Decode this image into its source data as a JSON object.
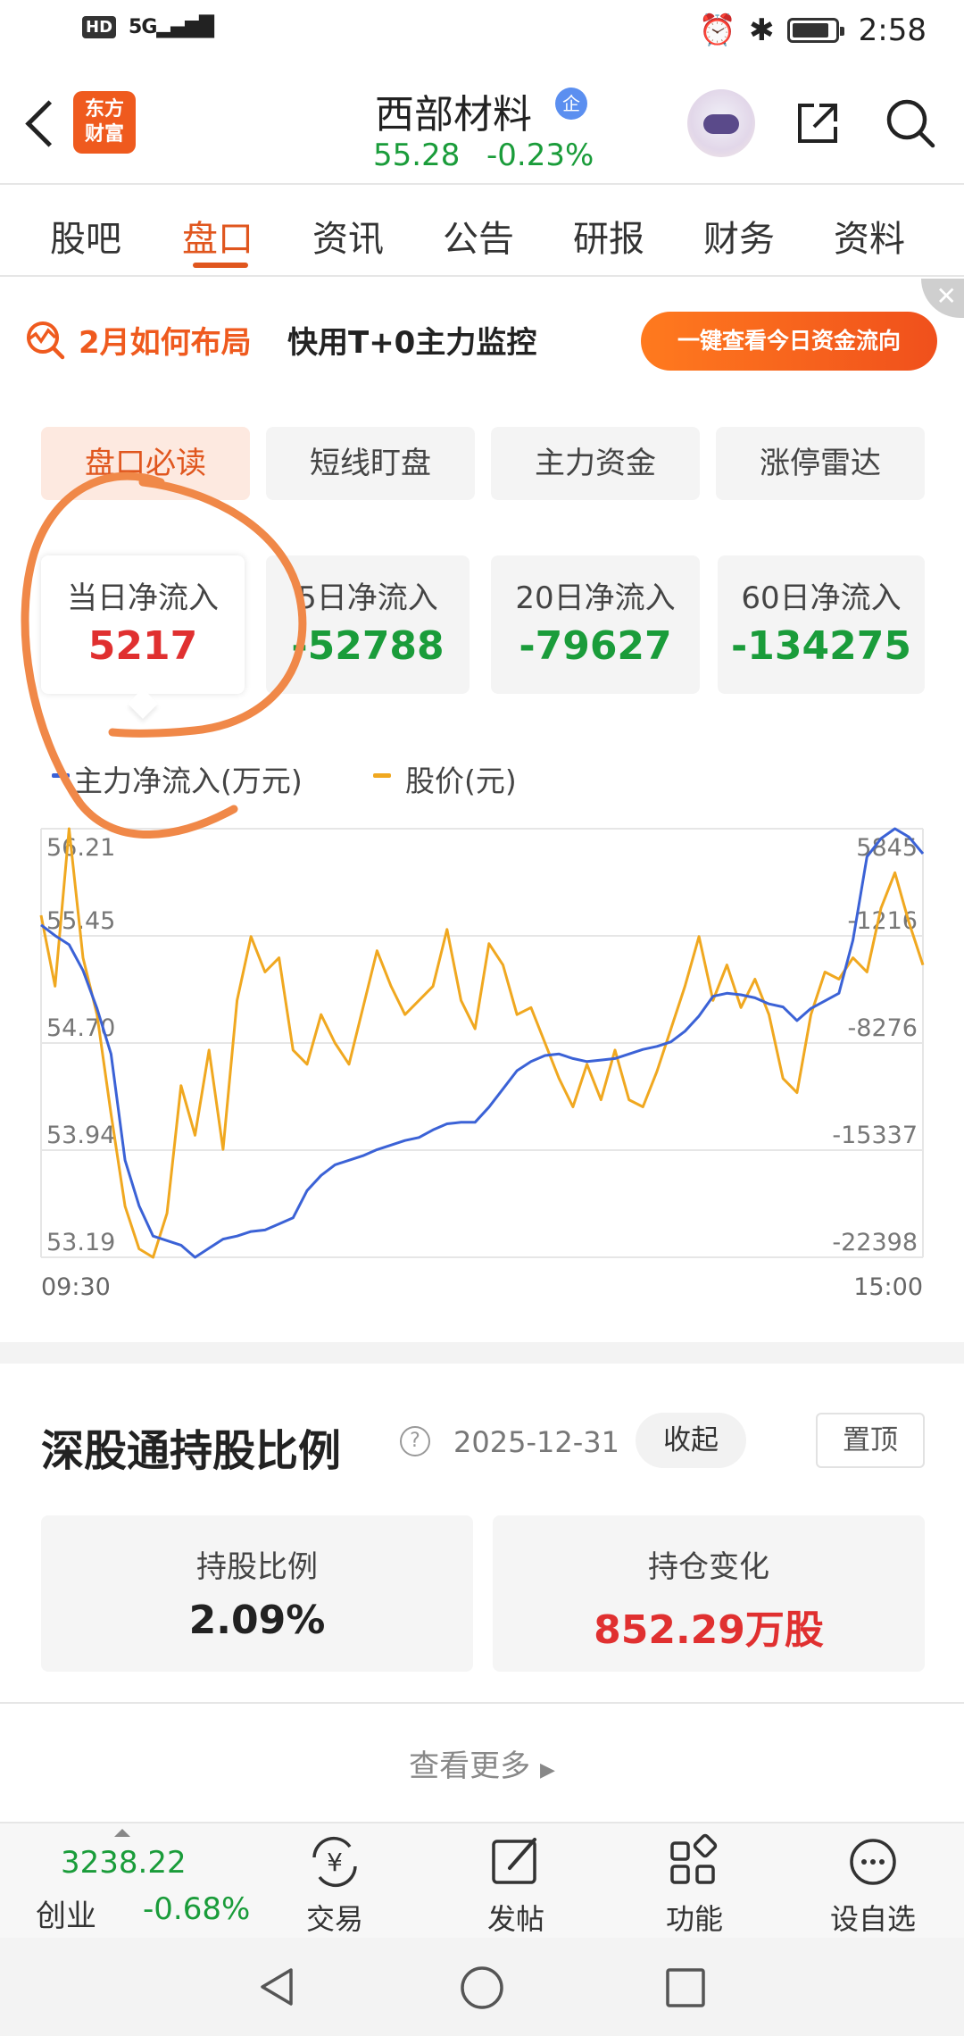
{
  "status_bar": {
    "hd": "HD",
    "network": "5G",
    "time": "2:58"
  },
  "header": {
    "logo_text_1": "东方",
    "logo_text_2": "财富",
    "stock_name": "西部材料",
    "badge": "企",
    "price": "55.28",
    "change": "-0.23%"
  },
  "tabs": [
    {
      "label": "股吧"
    },
    {
      "label": "盘口"
    },
    {
      "label": "资讯"
    },
    {
      "label": "公告"
    },
    {
      "label": "研报"
    },
    {
      "label": "财务"
    },
    {
      "label": "资料"
    }
  ],
  "banner": {
    "title": "2月如何布局",
    "subtitle": "快用T+0主力监控",
    "button": "一键查看今日资金流向",
    "close": "✕"
  },
  "subtabs": [
    {
      "label": "盘口必读"
    },
    {
      "label": "短线盯盘"
    },
    {
      "label": "主力资金"
    },
    {
      "label": "涨停雷达"
    }
  ],
  "flow_cards": [
    {
      "label": "当日净流入",
      "value": "5217"
    },
    {
      "label": "5日净流入",
      "value": "-52788"
    },
    {
      "label": "20日净流入",
      "value": "-79627"
    },
    {
      "label": "60日净流入",
      "value": "-134275"
    }
  ],
  "colors": {
    "accent": "#e0561e",
    "up": "#e03030",
    "down": "#1a9c3a",
    "flow_line": "#3b62d6",
    "price_line": "#f0a820",
    "annotation": "#f08848"
  },
  "chart_data": {
    "type": "line",
    "legend": [
      "主力净流入(万元)",
      "股价(元)"
    ],
    "x_start": "09:30",
    "x_end": "15:00",
    "left_ticks": [
      "56.21",
      "55.45",
      "54.70",
      "53.94",
      "53.19"
    ],
    "right_ticks": [
      "5845",
      "-1216",
      "-8276",
      "-15337",
      "-22398"
    ],
    "ylim_left": [
      53.19,
      56.21
    ],
    "ylim_right": [
      -22398,
      5845
    ],
    "series": [
      {
        "name": "主力净流入(万元)",
        "axis": "right",
        "values": [
          -500,
          -1200,
          -1800,
          -3500,
          -6000,
          -9000,
          -16000,
          -19000,
          -21000,
          -21300,
          -21600,
          -22400,
          -21800,
          -21200,
          -21000,
          -20700,
          -20600,
          -20200,
          -19800,
          -18000,
          -17000,
          -16300,
          -16000,
          -15700,
          -15300,
          -15000,
          -14700,
          -14500,
          -14000,
          -13600,
          -13500,
          -13500,
          -12500,
          -11300,
          -10100,
          -9500,
          -9100,
          -9000,
          -9300,
          -9500,
          -9400,
          -9300,
          -9000,
          -8700,
          -8500,
          -8200,
          -7500,
          -6500,
          -5200,
          -5000,
          -5100,
          -5300,
          -5700,
          -5900,
          -6800,
          -6000,
          -5500,
          -5000,
          -1500,
          4000,
          5200,
          5845,
          5300,
          4200
        ]
      },
      {
        "name": "股价(元)",
        "axis": "left",
        "values": [
          55.6,
          55.1,
          56.21,
          55.3,
          54.9,
          54.2,
          53.55,
          53.25,
          53.19,
          53.5,
          54.4,
          54.05,
          54.65,
          53.95,
          55.0,
          55.45,
          55.2,
          55.3,
          54.65,
          54.55,
          54.9,
          54.7,
          54.55,
          54.95,
          55.35,
          55.1,
          54.9,
          55.0,
          55.1,
          55.5,
          55.0,
          54.8,
          55.4,
          55.25,
          54.9,
          54.95,
          54.7,
          54.45,
          54.25,
          54.55,
          54.3,
          54.65,
          54.3,
          54.25,
          54.5,
          54.8,
          55.1,
          55.45,
          55.0,
          55.25,
          54.95,
          55.15,
          54.9,
          54.45,
          54.35,
          54.9,
          55.2,
          55.15,
          55.3,
          55.2,
          55.65,
          55.9,
          55.55,
          55.25
        ]
      }
    ]
  },
  "hk_section": {
    "title": "深股通持股比例",
    "help": "?",
    "date": "2025-12-31",
    "collapse": "收起",
    "pin": "置顶",
    "cards": [
      {
        "label": "持股比例",
        "value": "2.09%"
      },
      {
        "label": "持仓变化",
        "value": "852.29万股"
      }
    ],
    "more": "查看更多"
  },
  "bottom_nav": {
    "index_value": "3238.22",
    "index_name": "创业",
    "index_change": "-0.68%",
    "items": [
      {
        "label": "交易",
        "icon": "trade-icon"
      },
      {
        "label": "发帖",
        "icon": "post-icon"
      },
      {
        "label": "功能",
        "icon": "apps-icon"
      },
      {
        "label": "设自选",
        "icon": "more-icon"
      }
    ]
  }
}
